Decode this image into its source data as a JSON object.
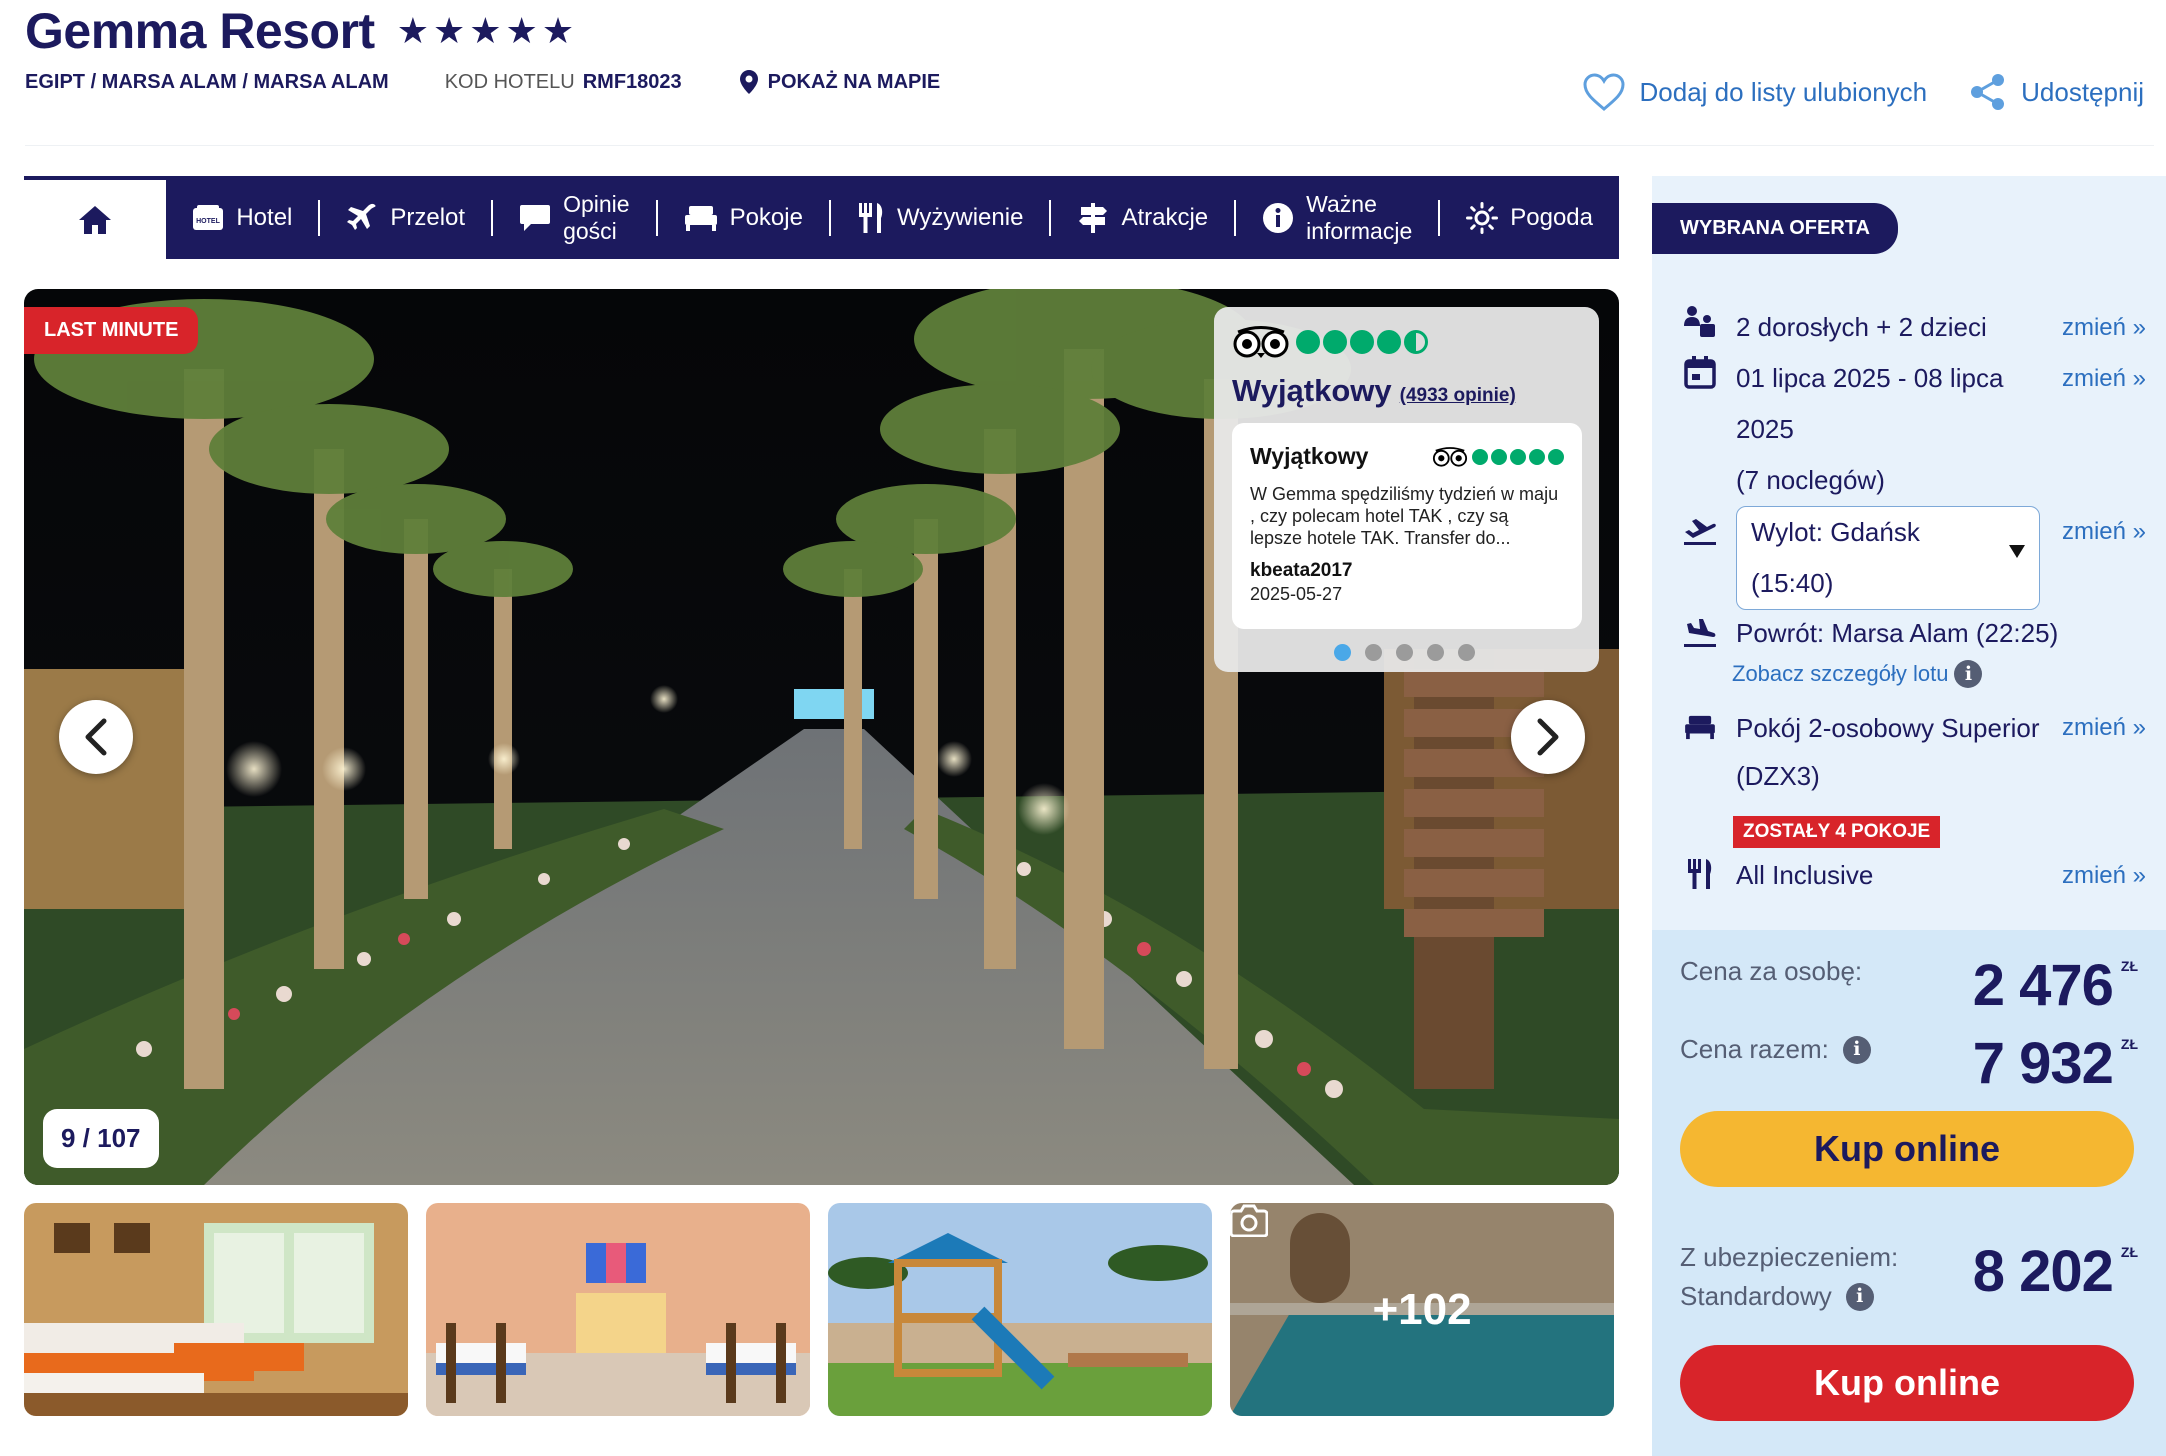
{
  "hotel": {
    "name": "Gemma Resort",
    "stars": 5,
    "breadcrumb": "EGIPT / MARSA ALAM / MARSA ALAM",
    "code_label": "KOD HOTELU",
    "code_value": "RMF18023",
    "map_link": "POKAŻ NA MAPIE"
  },
  "actions": {
    "favorite": "Dodaj do listy ulubionych",
    "share": "Udostępnij",
    "favorite_icon": "heart-icon",
    "share_icon": "share-icon"
  },
  "nav": {
    "home_icon": "home-icon",
    "items": [
      {
        "label": "Hotel",
        "icon": "hotel-icon"
      },
      {
        "label": "Przelot",
        "icon": "plane-icon"
      },
      {
        "label": "Opinie gości",
        "line1": "Opinie",
        "line2": "gości",
        "icon": "chat-icon"
      },
      {
        "label": "Pokoje",
        "icon": "bed-icon"
      },
      {
        "label": "Wyżywienie",
        "icon": "cutlery-icon"
      },
      {
        "label": "Atrakcje",
        "icon": "signpost-icon"
      },
      {
        "label": "Ważne informacje",
        "line1": "Ważne",
        "line2": "informacje",
        "icon": "info-icon"
      },
      {
        "label": "Pogoda",
        "icon": "sun-icon"
      }
    ]
  },
  "gallery": {
    "badge": "LAST MINUTE",
    "counter": "9 / 107",
    "more_count": "+102",
    "tripadvisor": {
      "bubbles_filled": 4.5,
      "rating_word": "Wyjątkowy",
      "review_count": "(4933 opinie)",
      "review": {
        "title": "Wyjątkowy",
        "bubbles_filled": 5,
        "text": "W Gemma spędziliśmy tydzień w maju , czy polecam hotel TAK , czy są lepsze hotele TAK. Transfer do...",
        "author": "kbeata2017",
        "date": "2025-05-27"
      },
      "dots": 5,
      "active_dot": 0
    }
  },
  "sidebar": {
    "offer_badge": "WYBRANA OFERTA",
    "change_label": "zmień »",
    "travelers": "2 dorosłych + 2 dzieci",
    "dates_line1": "01 lipca 2025 - 08 lipca",
    "dates_line2": "2025",
    "dates_line3": "(7 noclegów)",
    "departure_line1": "Wylot: Gdańsk",
    "departure_line2": "(15:40)",
    "return_flight": "Powrót: Marsa Alam (22:25)",
    "flight_details": "Zobacz szczegóły lotu",
    "room_line1": "Pokój 2-osobowy Superior",
    "room_line2": "(DZX3)",
    "rooms_left": "ZOSTAŁY 4 POKOJE",
    "board": "All Inclusive"
  },
  "prices": {
    "per_person_label": "Cena za osobę:",
    "per_person_value": "2 476",
    "total_label": "Cena razem:",
    "total_value": "7 932",
    "currency": "ZŁ",
    "buy_label": "Kup online",
    "insurance_label_line1": "Z ubezpieczeniem:",
    "insurance_label_line2": "Standardowy",
    "insurance_value": "8 202",
    "buy_label_2": "Kup online"
  },
  "colors": {
    "navy": "#1c1a5e",
    "blue": "#2c6fbf",
    "red": "#d8242a",
    "yellow": "#f5b731",
    "panel": "#e8f2fb",
    "price_panel": "#d4e8f8",
    "tripadvisor_green": "#00aa6c"
  }
}
